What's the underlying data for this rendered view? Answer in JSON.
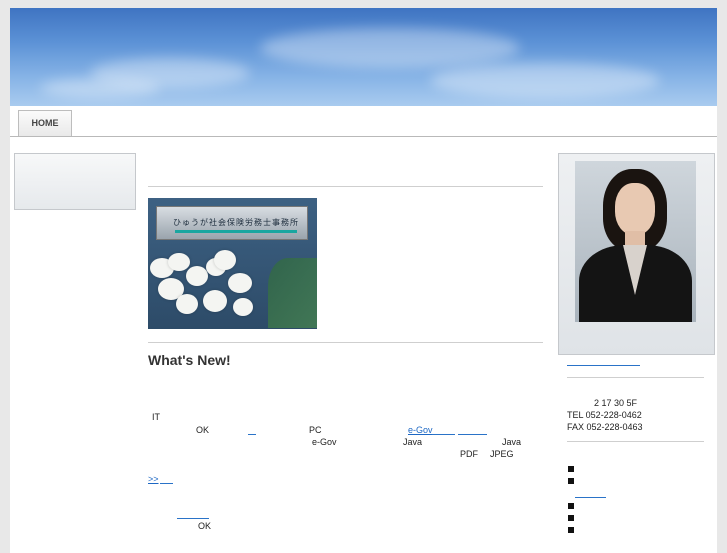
{
  "nav": {
    "home_label": "HOME"
  },
  "photo": {
    "sign_text": "ひゅうが社会保険労務士事務所"
  },
  "main": {
    "heading": "What's New!",
    "line1_it": "IT",
    "line2_ok": "OK",
    "line2_pc": "PC",
    "line2_egov_link": "e-Gov",
    "line3_egov": "e-Gov",
    "line3_java1": "Java",
    "line3_java2": "Java",
    "line4_pdf": "PDF",
    "line4_jpeg": "JPEG",
    "more_link": ">>",
    "bottom_ok": "OK"
  },
  "sidebar": {
    "address": "2  17 30       5F",
    "tel": "TEL 052-228-0462",
    "fax": "FAX 052-228-0463"
  }
}
